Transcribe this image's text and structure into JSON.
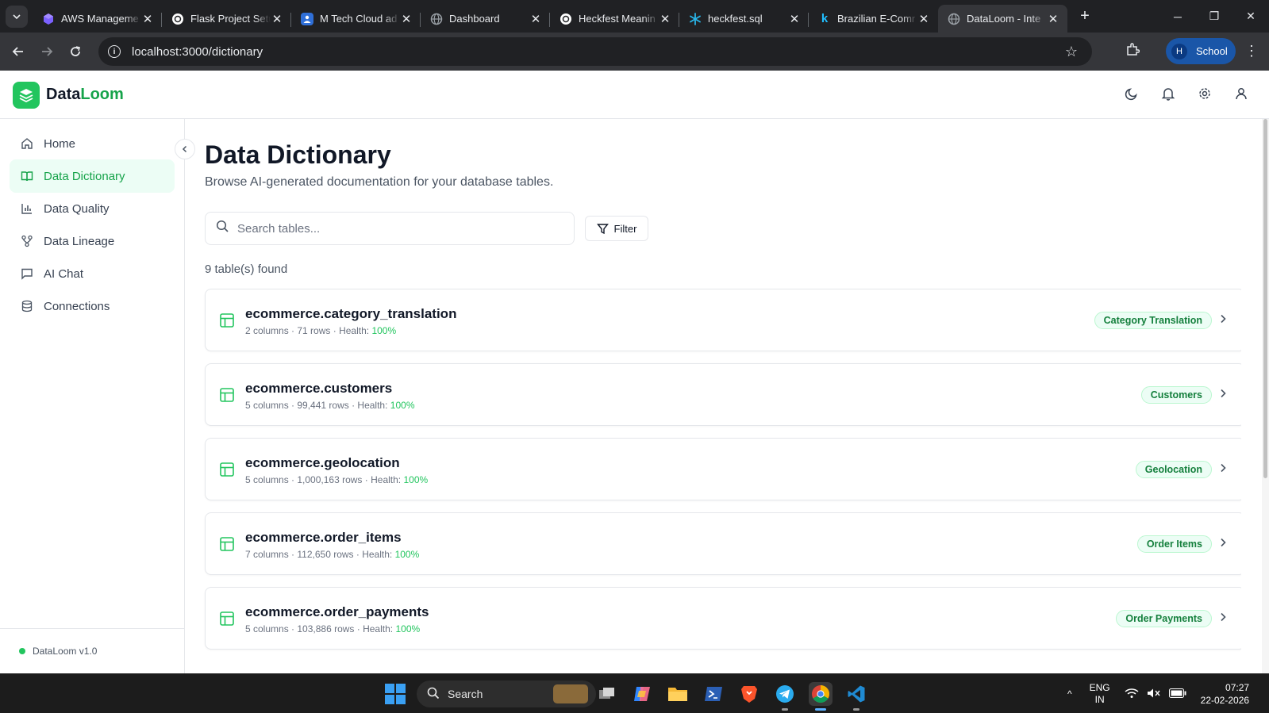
{
  "browser": {
    "tabs": [
      {
        "title": "AWS Manageme",
        "favicon": "aws-cube-icon",
        "color": "#7b61ff"
      },
      {
        "title": "Flask Project Setu",
        "favicon": "chatgpt-icon",
        "color": "#ffffff"
      },
      {
        "title": "M Tech Cloud ad",
        "favicon": "contact-card-icon",
        "color": "#2f6fd8"
      },
      {
        "title": "Dashboard",
        "favicon": "globe-icon",
        "color": "#9aa0a6"
      },
      {
        "title": "Heckfest Meanin",
        "favicon": "chatgpt-icon",
        "color": "#ffffff"
      },
      {
        "title": "heckfest.sql",
        "favicon": "snowflake-icon",
        "color": "#29b5e8"
      },
      {
        "title": "Brazilian E-Comr",
        "favicon": "kaggle-icon",
        "color": "#20beff"
      },
      {
        "title": "DataLoom - Inte",
        "favicon": "globe-icon",
        "color": "#9aa0a6",
        "active": true
      }
    ],
    "url": "localhost:3000/dictionary",
    "profile_initial": "H",
    "profile_label": "School"
  },
  "app": {
    "brand_main": "Data",
    "brand_accent": "Loom",
    "accent_color": "#22c55e",
    "header_icons": [
      "moon-icon",
      "bell-icon",
      "settings-icon",
      "user-icon"
    ]
  },
  "sidebar": {
    "items": [
      {
        "label": "Home",
        "icon": "home-icon"
      },
      {
        "label": "Data Dictionary",
        "icon": "book-icon",
        "active": true
      },
      {
        "label": "Data Quality",
        "icon": "bar-chart-icon"
      },
      {
        "label": "Data Lineage",
        "icon": "lineage-icon"
      },
      {
        "label": "AI Chat",
        "icon": "chat-icon"
      },
      {
        "label": "Connections",
        "icon": "database-icon"
      }
    ],
    "footer": "DataLoom v1.0"
  },
  "main": {
    "title": "Data Dictionary",
    "subtitle": "Browse AI-generated documentation for your database tables.",
    "search_placeholder": "Search tables...",
    "filter_label": "Filter",
    "count_text": "9 table(s) found",
    "tables": [
      {
        "name": "ecommerce.category_translation",
        "columns": "2 columns",
        "rows": "71 rows",
        "health_label": "Health:",
        "health": "100%",
        "badge": "Category Translation"
      },
      {
        "name": "ecommerce.customers",
        "columns": "5 columns",
        "rows": "99,441 rows",
        "health_label": "Health:",
        "health": "100%",
        "badge": "Customers"
      },
      {
        "name": "ecommerce.geolocation",
        "columns": "5 columns",
        "rows": "1,000,163 rows",
        "health_label": "Health:",
        "health": "100%",
        "badge": "Geolocation"
      },
      {
        "name": "ecommerce.order_items",
        "columns": "7 columns",
        "rows": "112,650 rows",
        "health_label": "Health:",
        "health": "100%",
        "badge": "Order Items"
      },
      {
        "name": "ecommerce.order_payments",
        "columns": "5 columns",
        "rows": "103,886 rows",
        "health_label": "Health:",
        "health": "100%",
        "badge": "Order Payments"
      }
    ]
  },
  "taskbar": {
    "search_label": "Search",
    "apps": [
      "task-view-icon",
      "copilot-icon",
      "file-explorer-icon",
      "terminal-icon",
      "brave-icon",
      "telegram-icon",
      "chrome-icon",
      "vscode-icon"
    ],
    "lang_top": "ENG",
    "lang_bottom": "IN",
    "time": "07:27",
    "date": "22-02-2026"
  }
}
